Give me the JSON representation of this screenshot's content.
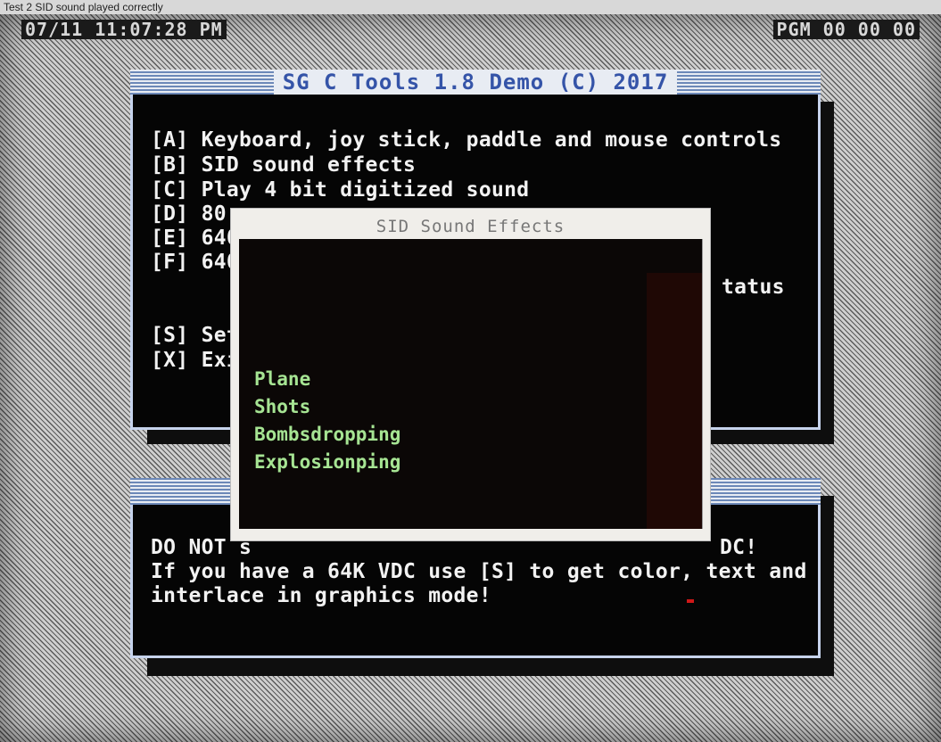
{
  "caption": "Test 2 SID sound played correctly",
  "status_bar": {
    "left": "07/11 11:07:28 PM",
    "right": "PGM 00 00 00"
  },
  "main_window": {
    "title": "SG C Tools 1.8 Demo (C) 2017",
    "lines": [
      "[A] Keyboard, joy stick, paddle and mouse controls",
      "[B] SID sound effects",
      "[C] Play 4 bit digitized sound",
      "[D] 80",
      "[E] 640",
      "[F] 640",
      "[S] Set",
      "[X] Exi"
    ],
    "partial_right": "tatus"
  },
  "message_window": {
    "line1_left": "DO NOT s",
    "line1_right": "DC!",
    "line2": "If you have a 64K VDC use [S] to get color, text and",
    "line3": "interlace in graphics mode!"
  },
  "dialog": {
    "title": "SID Sound Effects",
    "items": [
      "Plane",
      "Shots",
      "Bombsdropping",
      "Explosionping"
    ]
  },
  "colors": {
    "screen_bg": "#cfcfcf",
    "window_bg": "#050505",
    "title_text": "#3554a8",
    "title_bar": "#e8ecf3",
    "window_border": "#c6d3ec",
    "menu_text": "#f2f2f2",
    "dialog_bg": "#f0eeea",
    "dialog_item_text": "#a6e493"
  }
}
